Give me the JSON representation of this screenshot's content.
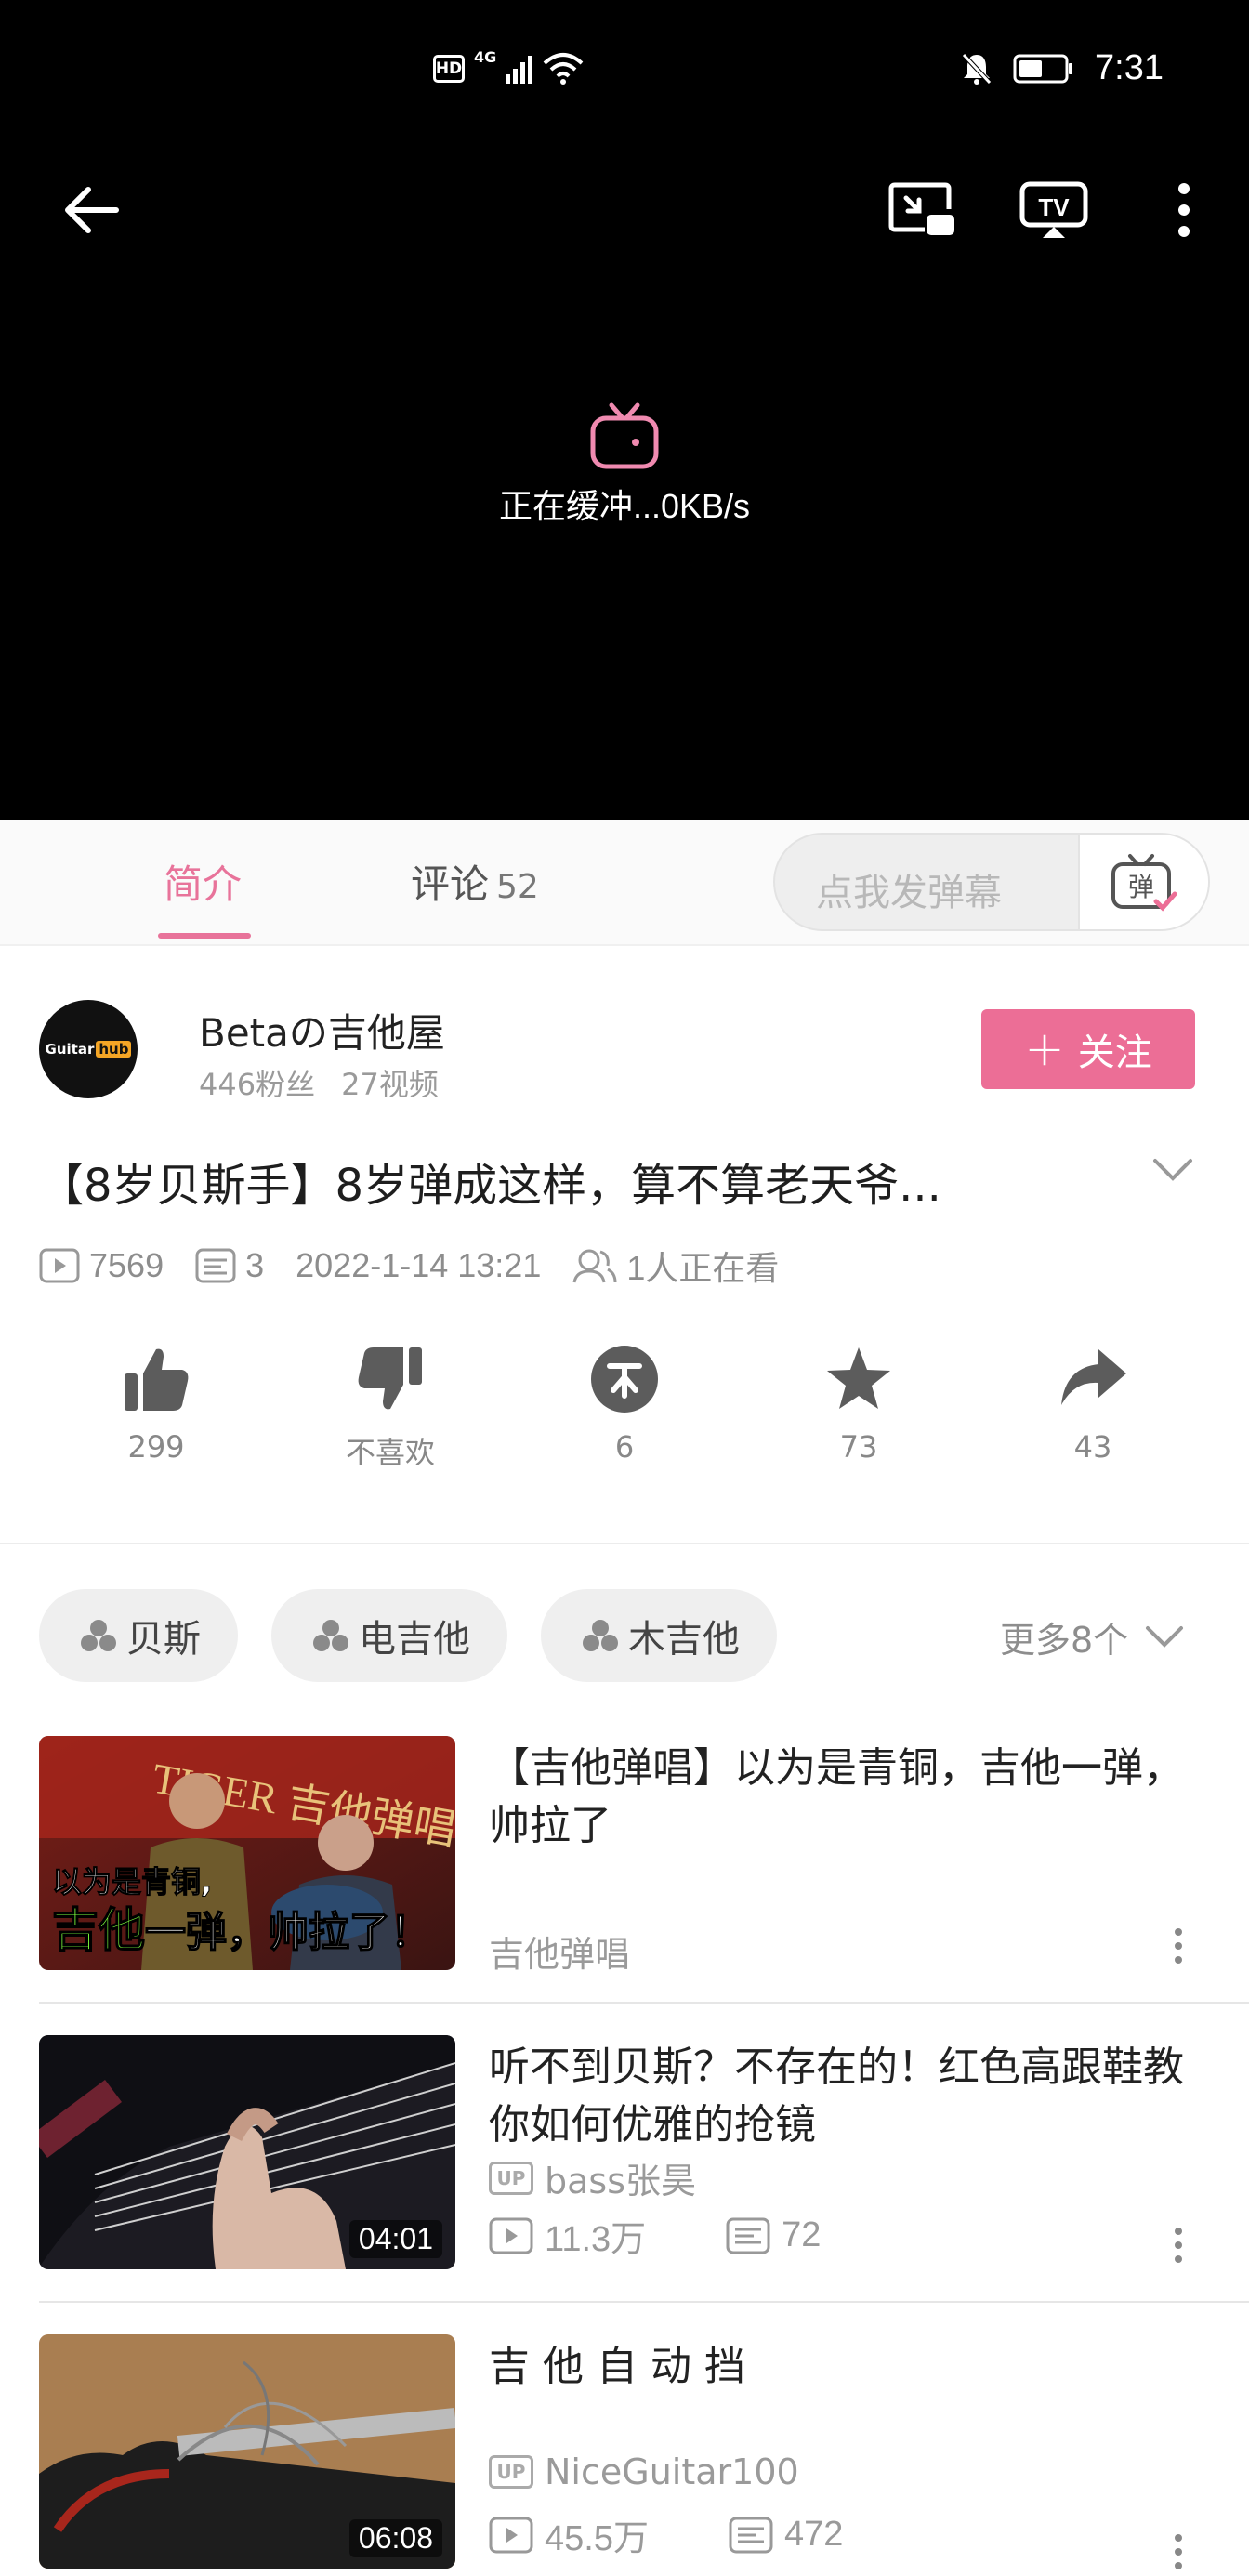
{
  "status_bar": {
    "hd": "HD",
    "network": "4G",
    "time": "7:31"
  },
  "player": {
    "buffering_text": "正在缓冲...0KB/s",
    "icons": [
      "back-arrow-icon",
      "picture-in-picture-icon",
      "tv-cast-icon",
      "more-vertical-icon"
    ]
  },
  "tabs": {
    "intro_label": "简介",
    "comments_label": "评论",
    "comments_count": "52",
    "danmaku_placeholder": "点我发弹幕",
    "danmaku_button": "弹"
  },
  "uploader": {
    "avatar_text": "Guitar",
    "avatar_badge": "hub",
    "name": "Betaの吉他屋",
    "followers": "446粉丝",
    "videos": "27视频",
    "follow_label": "关注"
  },
  "video": {
    "title": "【8岁贝斯手】8岁弹成这样，算不算老天爷...",
    "views": "7569",
    "danmaku_count": "3",
    "date": "2022-1-14 13:21",
    "watching": "1人正在看"
  },
  "actions": [
    {
      "icon": "thumbs-up-icon",
      "label": "299"
    },
    {
      "icon": "thumbs-down-icon",
      "label": "不喜欢"
    },
    {
      "icon": "coin-icon",
      "label": "6"
    },
    {
      "icon": "star-icon",
      "label": "73"
    },
    {
      "icon": "share-icon",
      "label": "43"
    }
  ],
  "tags": [
    "贝斯",
    "电吉他",
    "木吉他"
  ],
  "more_tags": "更多8个",
  "related": [
    {
      "title": "【吉他弹唱】以为是青铜，吉他一弹，帅拉了",
      "category": "吉他弹唱",
      "thumb_caption_1": "以为是青铜,",
      "thumb_caption_green": "吉他",
      "thumb_caption_2": "一弹，帅拉了！",
      "thumb_sign": "TIGER 吉他弹唱"
    },
    {
      "title": "听不到贝斯？不存在的！红色高跟鞋教你如何优雅的抢镜",
      "uploader": "bass张昊",
      "up_badge": "UP",
      "views": "11.3万",
      "danmaku": "72",
      "duration": "04:01"
    },
    {
      "title": "吉 他 自 动 挡",
      "uploader": "NiceGuitar100",
      "up_badge": "UP",
      "views": "45.5万",
      "danmaku": "472",
      "duration": "06:08"
    }
  ],
  "colors": {
    "accent_pink": "#ec6e96",
    "tab_pink": "#e8739a",
    "player_bg": "#000000"
  }
}
